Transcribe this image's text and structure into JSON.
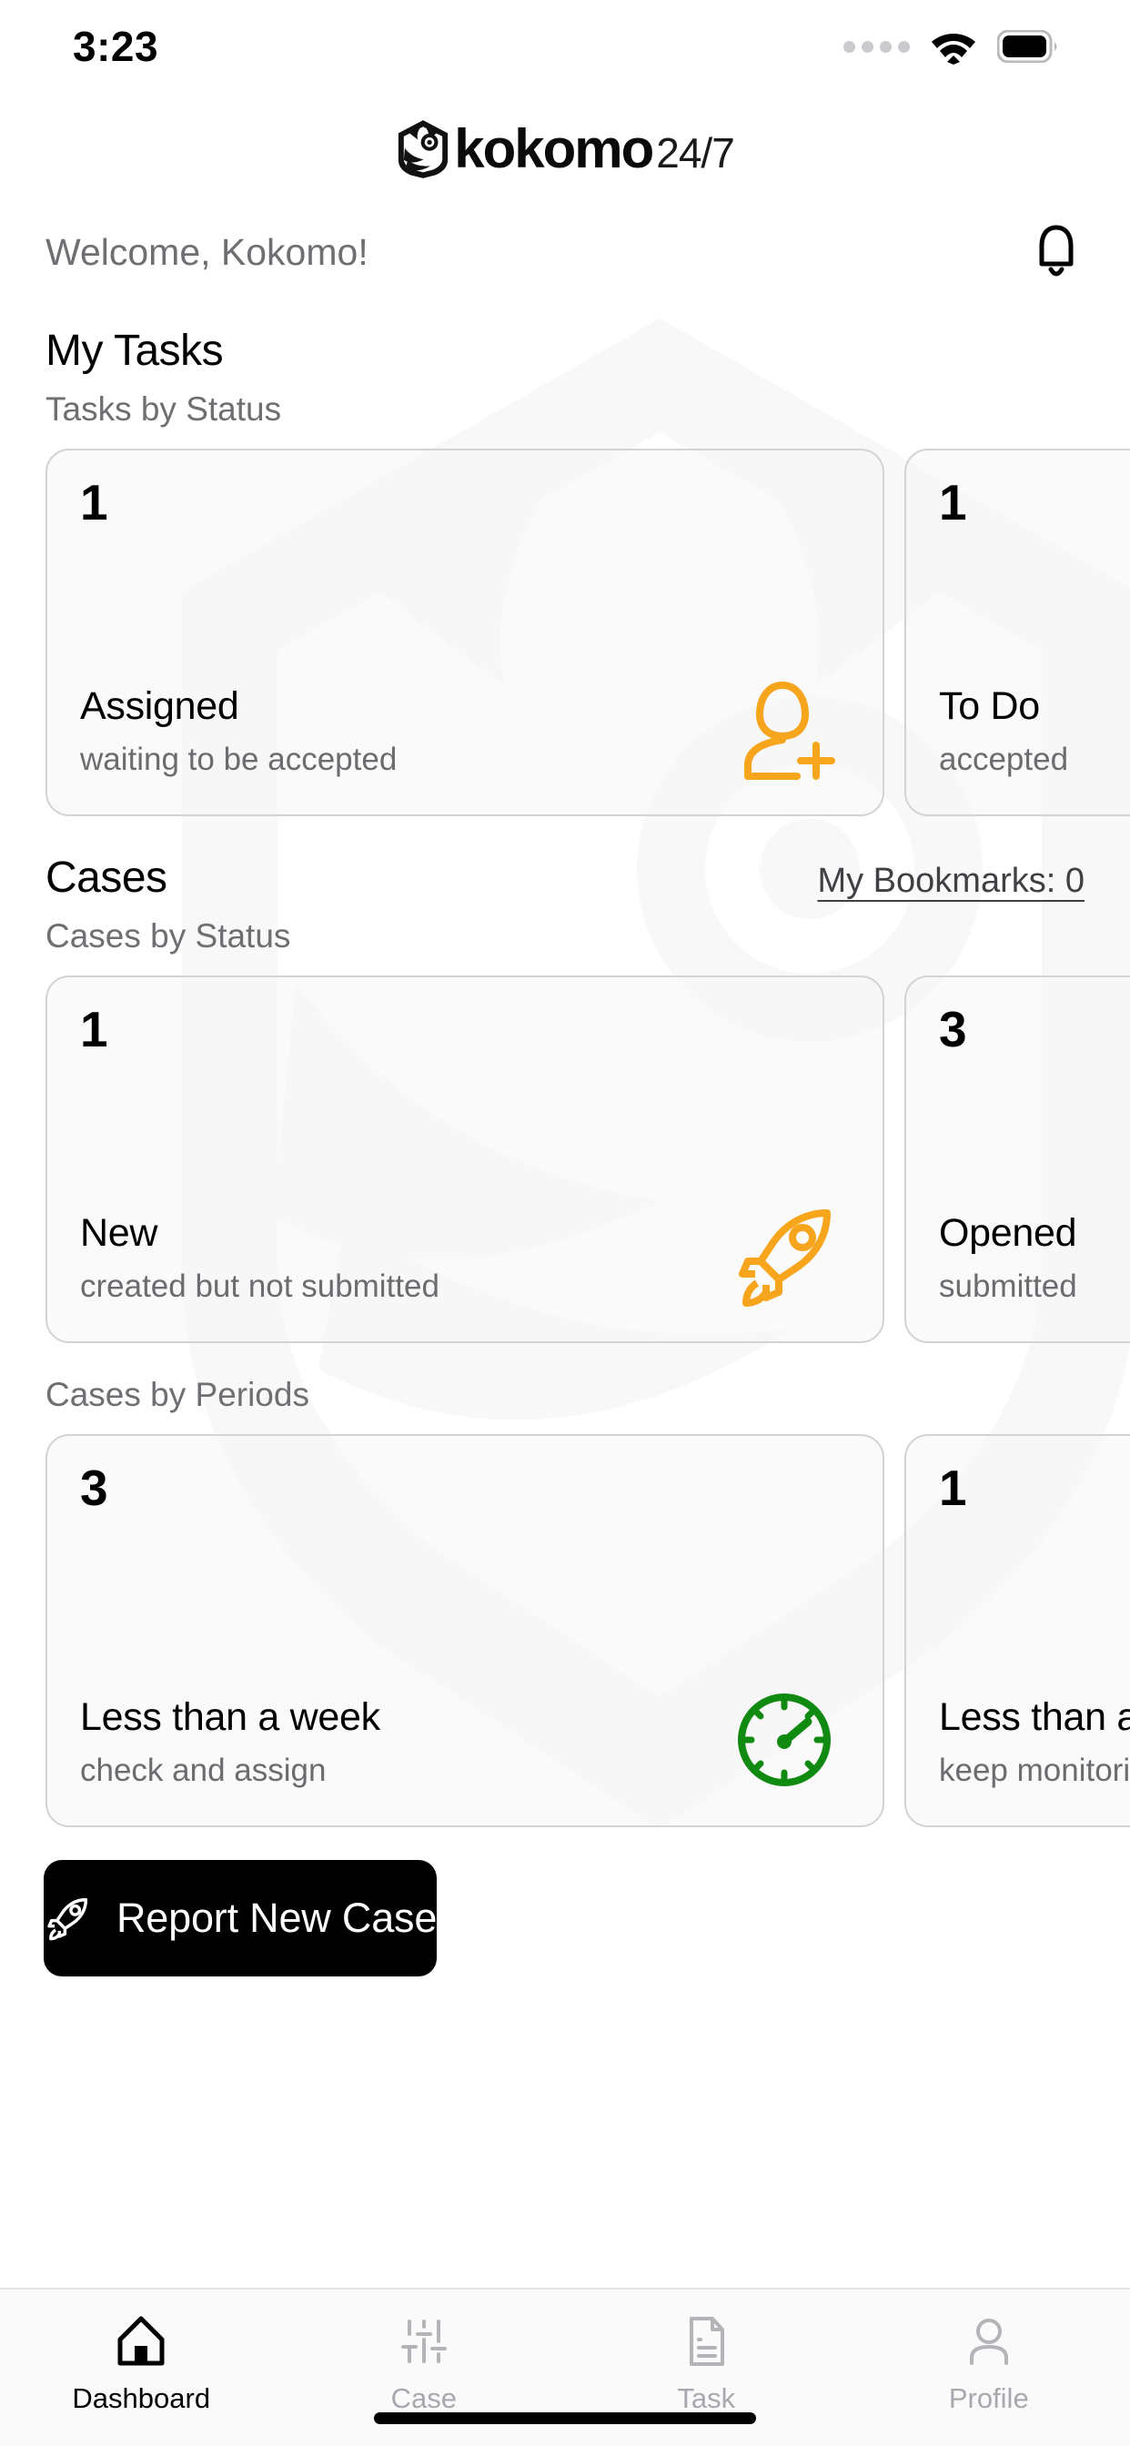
{
  "status_bar": {
    "time": "3:23",
    "signal_icon": "signal-dots-icon",
    "wifi_icon": "wifi-icon",
    "battery_icon": "battery-full-icon"
  },
  "brand": {
    "logo_icon": "owl-logo-icon",
    "name": "kokomo",
    "suffix": "24/7"
  },
  "header": {
    "welcome": "Welcome, Kokomo!",
    "bell_icon": "bell-icon"
  },
  "tasks": {
    "title": "My Tasks",
    "subtitle": "Tasks by Status",
    "cards": [
      {
        "count": "1",
        "label": "Assigned",
        "desc": "waiting to be accepted",
        "icon": "add-person-icon",
        "icon_color": "#F7A51C"
      },
      {
        "count": "1",
        "label": "To Do",
        "desc": "accepted",
        "icon": "checklist-icon",
        "icon_color": "#F7A51C"
      }
    ]
  },
  "cases": {
    "title": "Cases",
    "bookmarks_link": "My Bookmarks: 0",
    "status_subtitle": "Cases by Status",
    "status_cards": [
      {
        "count": "1",
        "label": "New",
        "desc": "created but not submitted",
        "icon": "rocket-icon",
        "icon_color": "#F7A51C"
      },
      {
        "count": "3",
        "label": "Opened",
        "desc": "submitted",
        "icon": "folder-open-icon",
        "icon_color": "#F7A51C"
      }
    ],
    "periods_subtitle": "Cases by Periods",
    "period_cards": [
      {
        "count": "3",
        "label": "Less than a week",
        "desc": "check and assign",
        "icon": "gauge-icon",
        "icon_color": "#118A11"
      },
      {
        "count": "1",
        "label": "Less than a month",
        "desc": "keep monitoring",
        "icon": "gauge-icon",
        "icon_color": "#118A11"
      }
    ]
  },
  "report_button": {
    "label": "Report New Case",
    "icon": "rocket-icon",
    "background": "#000000",
    "text_color": "#FFFFFF"
  },
  "tabbar": {
    "items": [
      {
        "label": "Dashboard",
        "icon": "home-icon",
        "active": true
      },
      {
        "label": "Case",
        "icon": "sliders-icon",
        "active": false
      },
      {
        "label": "Task",
        "icon": "document-icon",
        "active": false
      },
      {
        "label": "Profile",
        "icon": "person-icon",
        "active": false
      }
    ]
  },
  "colors": {
    "accent_orange": "#F7A51C",
    "accent_green": "#118A11",
    "card_border": "#D3D3D6",
    "muted_text": "#6E6E73"
  }
}
